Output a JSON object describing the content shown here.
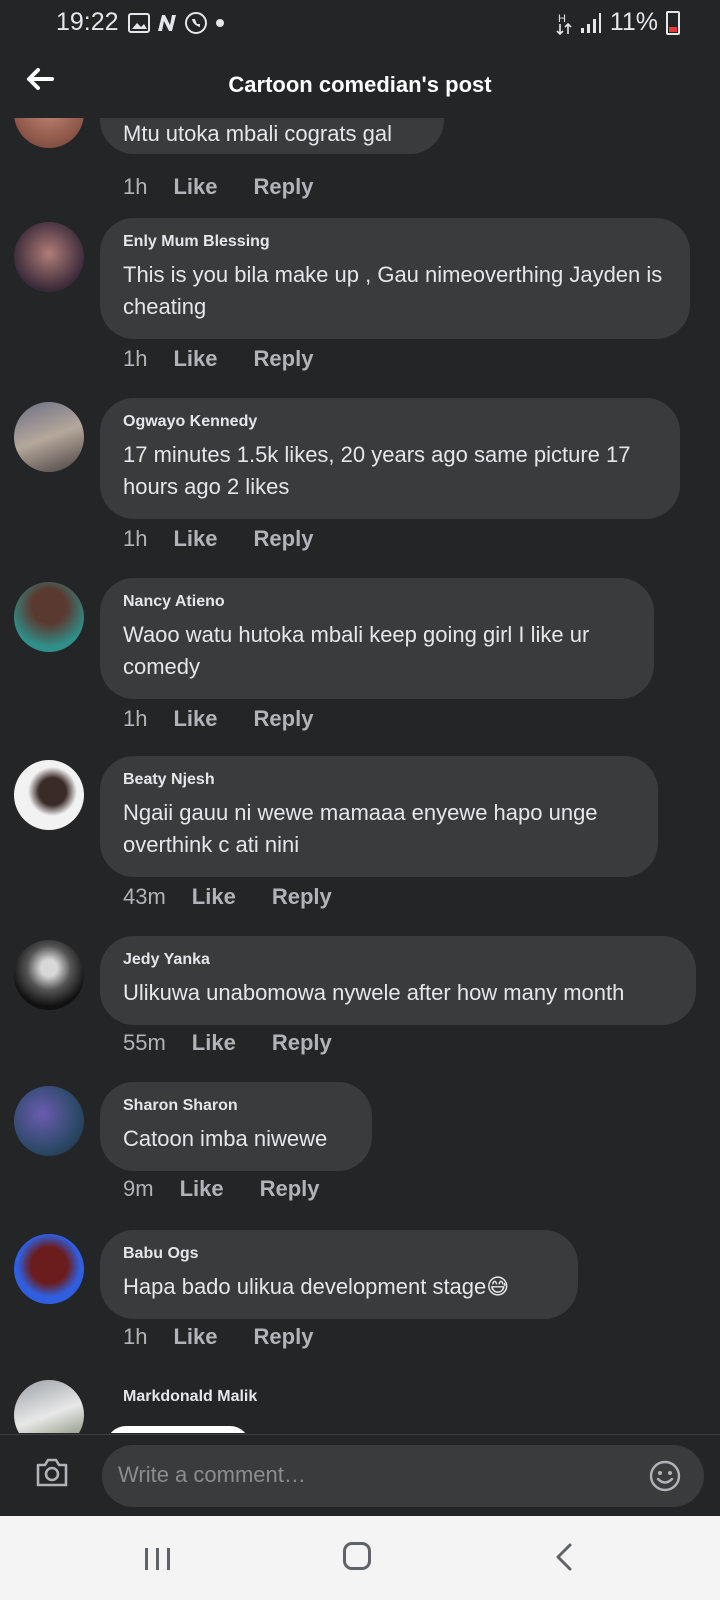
{
  "status_bar": {
    "time": "19:22",
    "battery": "11%",
    "icons": [
      "gallery-icon",
      "n-icon",
      "whatsapp-icon",
      "dot-icon",
      "data-arrows-icon",
      "signal-icon",
      "battery-icon"
    ]
  },
  "header": {
    "title": "Cartoon comedian's post",
    "back_icon": "arrow-left-icon"
  },
  "partial_comment": {
    "text": "Mtu utoka mbali cograts gal",
    "time": "1h",
    "like": "Like",
    "reply": "Reply"
  },
  "comments": [
    {
      "name": "Enly Mum Blessing",
      "text": "This is you bila make up , Gau nimeoverthing Jayden is cheating",
      "time": "1h",
      "like": "Like",
      "reply": "Reply"
    },
    {
      "name": "Ogwayo Kennedy",
      "text": "17 minutes 1.5k likes, 20 years ago same picture 17 hours ago 2 likes",
      "time": "1h",
      "like": "Like",
      "reply": "Reply"
    },
    {
      "name": "Nancy Atieno",
      "text": "Waoo watu hutoka mbali keep going girl I like ur comedy",
      "time": "1h",
      "like": "Like",
      "reply": "Reply"
    },
    {
      "name": "Beaty Njesh",
      "text": "Ngaii gauu ni wewe mamaaa enyewe hapo unge overthink c ati nini",
      "time": "43m",
      "like": "Like",
      "reply": "Reply"
    },
    {
      "name": "Jedy Yanka",
      "text": "Ulikuwa unabomowa nywele after how many month",
      "time": "55m",
      "like": "Like",
      "reply": "Reply"
    },
    {
      "name": "Sharon Sharon",
      "text": "Catoon imba niwewe",
      "time": "9m",
      "like": "Like",
      "reply": "Reply"
    },
    {
      "name": "Babu Ogs",
      "text": "Hapa bado ulikua development stage😅",
      "time": "1h",
      "like": "Like",
      "reply": "Reply"
    },
    {
      "name": "Markdonald Malik"
    }
  ],
  "composer": {
    "placeholder": "Write a comment…",
    "camera_icon": "camera-icon",
    "emoji_icon": "emoji-icon"
  },
  "nav_bar": {
    "icons": [
      "recents-icon",
      "home-icon",
      "back-icon"
    ]
  }
}
